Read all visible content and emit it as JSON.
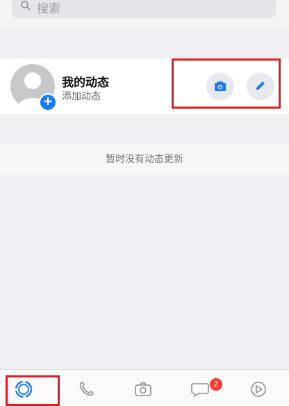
{
  "search": {
    "placeholder": "搜索"
  },
  "status": {
    "title": "我的动态",
    "subtitle": "添加动态",
    "add_symbol": "+"
  },
  "empty_state": {
    "text": "暂时没有动态更新"
  },
  "tabbar": {
    "chats_badge": "2"
  },
  "icons": {
    "search": "search-icon",
    "add": "plus-icon",
    "camera": "camera-icon",
    "edit": "pencil-icon",
    "status_tab": "status-ring-icon",
    "calls_tab": "phone-icon",
    "camera_tab": "camera-icon",
    "chats_tab": "chat-bubble-icon",
    "settings_tab": "settings-icon"
  },
  "colors": {
    "accent": "#1a7cf5",
    "highlight": "#e11b22",
    "badge": "#ff3b30"
  }
}
